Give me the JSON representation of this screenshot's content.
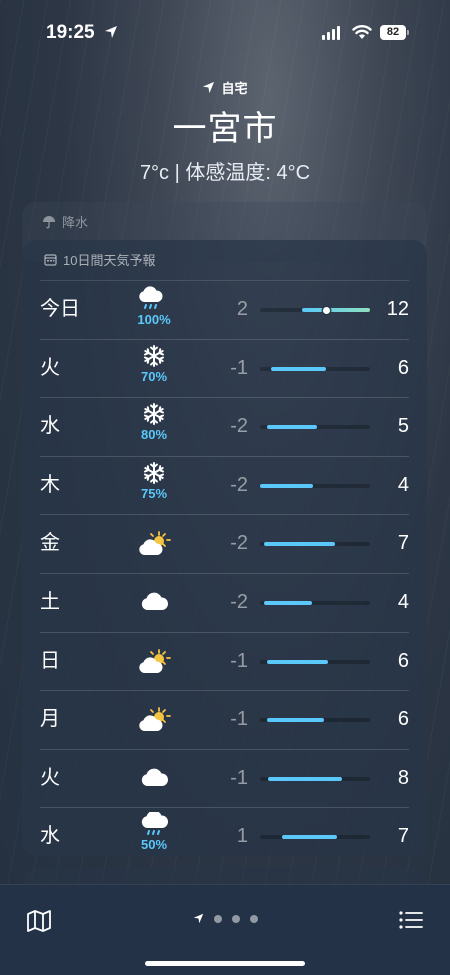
{
  "status": {
    "time": "19:25",
    "battery": "82"
  },
  "header": {
    "home_label": "自宅",
    "city": "一宮市",
    "current": "7°c | 体感温度: 4°C"
  },
  "precip_header": {
    "label": "降水"
  },
  "forecast": {
    "title": "10日間天気予報",
    "rows": [
      {
        "day": "今日",
        "icon": "cloud-moon-rain-icon",
        "precip": "100%",
        "low": "2",
        "high": "12",
        "range": [
          0.38,
          1.0
        ],
        "current": 0.6
      },
      {
        "day": "火",
        "icon": "snowflake-icon",
        "precip": "70%",
        "low": "-1",
        "high": "6",
        "range": [
          0.1,
          0.6
        ]
      },
      {
        "day": "水",
        "icon": "snowflake-icon",
        "precip": "80%",
        "low": "-2",
        "high": "5",
        "range": [
          0.06,
          0.52
        ]
      },
      {
        "day": "木",
        "icon": "snowflake-icon",
        "precip": "75%",
        "low": "-2",
        "high": "4",
        "range": [
          0.0,
          0.48
        ]
      },
      {
        "day": "金",
        "icon": "partly-sunny-icon",
        "precip": "",
        "low": "-2",
        "high": "7",
        "range": [
          0.04,
          0.68
        ]
      },
      {
        "day": "土",
        "icon": "cloud-icon",
        "precip": "",
        "low": "-2",
        "high": "4",
        "range": [
          0.04,
          0.47
        ]
      },
      {
        "day": "日",
        "icon": "partly-sunny-icon",
        "precip": "",
        "low": "-1",
        "high": "6",
        "range": [
          0.06,
          0.62
        ]
      },
      {
        "day": "月",
        "icon": "partly-sunny-icon",
        "precip": "",
        "low": "-1",
        "high": "6",
        "range": [
          0.06,
          0.58
        ]
      },
      {
        "day": "火",
        "icon": "cloud-icon",
        "precip": "",
        "low": "-1",
        "high": "8",
        "range": [
          0.07,
          0.75
        ]
      },
      {
        "day": "水",
        "icon": "cloud-rain-icon",
        "precip": "50%",
        "low": "1",
        "high": "7",
        "range": [
          0.2,
          0.7
        ]
      }
    ]
  },
  "colors": {
    "accent": "#5ac8fa",
    "sun": "#f5c542"
  }
}
